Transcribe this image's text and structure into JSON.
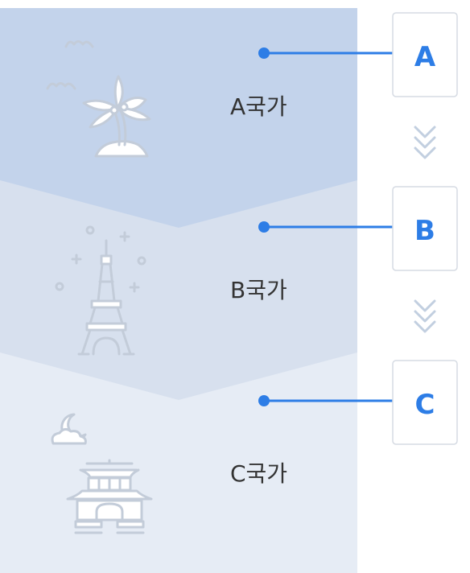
{
  "stages": [
    {
      "letter": "A",
      "label": "A국가",
      "icon": "palm-tree-island-icon"
    },
    {
      "letter": "B",
      "label": "B국가",
      "icon": "eiffel-tower-icon"
    },
    {
      "letter": "C",
      "label": "C국가",
      "icon": "korean-gate-icon"
    }
  ],
  "colors": {
    "band_a": "#c3d3eb",
    "band_b": "#d7e0ee",
    "band_c": "#e6ecf5",
    "accent": "#2d7de6",
    "icon": "#c3ccd9",
    "chevron": "#c2cfe0"
  }
}
